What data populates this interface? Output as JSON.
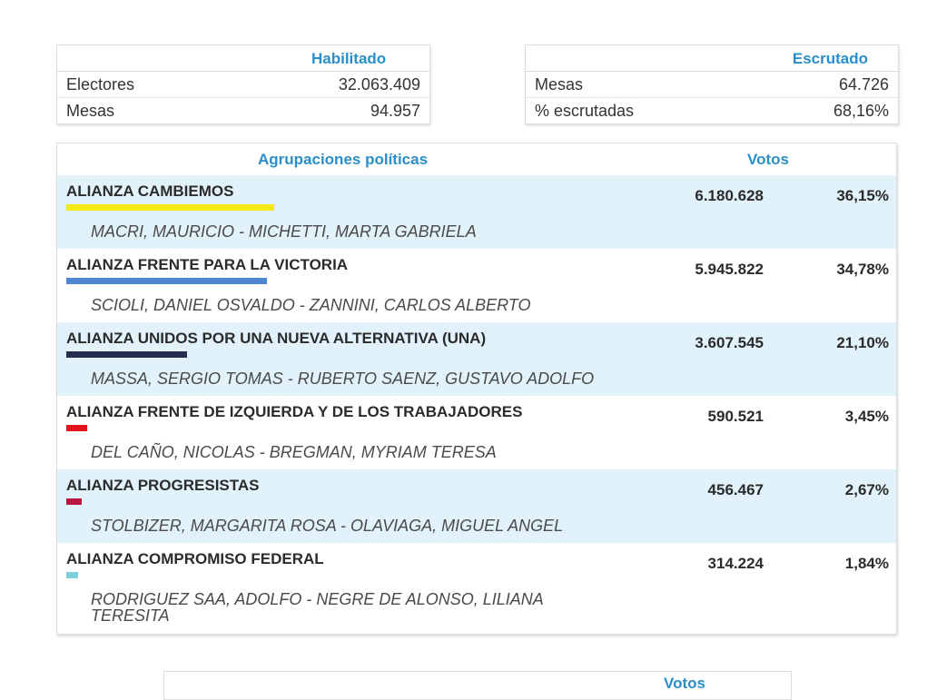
{
  "habilitado": {
    "header": "Habilitado",
    "rows": [
      {
        "label": "Electores",
        "value": "32.063.409"
      },
      {
        "label": "Mesas",
        "value": "94.957"
      }
    ]
  },
  "escrutado": {
    "header": "Escrutado",
    "rows": [
      {
        "label": "Mesas",
        "value": "64.726"
      },
      {
        "label": "% escrutadas",
        "value": "68,16%"
      }
    ]
  },
  "results": {
    "header_party": "Agrupaciones políticas",
    "header_votes": "Votos",
    "parties": [
      {
        "name": "ALIANZA CAMBIEMOS",
        "candidates": "MACRI, MAURICIO - MICHETTI, MARTA GABRIELA",
        "votes": "6.180.628",
        "percent": "36,15%",
        "color": "#f5ea14"
      },
      {
        "name": "ALIANZA FRENTE PARA LA VICTORIA",
        "candidates": "SCIOLI, DANIEL OSVALDO - ZANNINI, CARLOS ALBERTO",
        "votes": "5.945.822",
        "percent": "34,78%",
        "color": "#4e86d4"
      },
      {
        "name": "ALIANZA UNIDOS POR UNA NUEVA ALTERNATIVA (UNA)",
        "candidates": "MASSA, SERGIO TOMAS - RUBERTO SAENZ, GUSTAVO ADOLFO",
        "votes": "3.607.545",
        "percent": "21,10%",
        "color": "#262d4f"
      },
      {
        "name": "ALIANZA FRENTE DE IZQUIERDA Y DE LOS TRABAJADORES",
        "candidates": "DEL CAÑO, NICOLAS - BREGMAN, MYRIAM TERESA",
        "votes": "590.521",
        "percent": "3,45%",
        "color": "#e3141c"
      },
      {
        "name": "ALIANZA PROGRESISTAS",
        "candidates": "STOLBIZER, MARGARITA ROSA - OLAVIAGA, MIGUEL ANGEL",
        "votes": "456.467",
        "percent": "2,67%",
        "color": "#b8173f"
      },
      {
        "name": "ALIANZA COMPROMISO FEDERAL",
        "candidates": "RODRIGUEZ SAA, ADOLFO - NEGRE DE ALONSO, LILIANA TERESITA",
        "votes": "314.224",
        "percent": "1,84%",
        "color": "#7fcfdc"
      }
    ]
  },
  "footer": {
    "header": "Votos"
  }
}
